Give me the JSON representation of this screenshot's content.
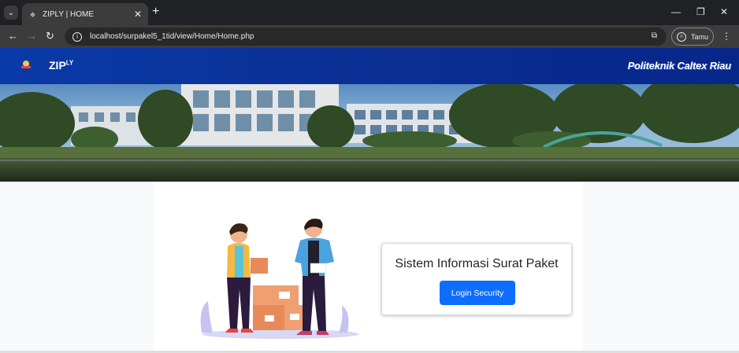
{
  "browser": {
    "tab_title": "ZIPLY | HOME",
    "url": "localhost/surpakel5_1tid/view/Home/Home.php",
    "profile_label": "Tamu"
  },
  "navbar": {
    "brand": "ZIP",
    "brand_sup": "LY",
    "institution_main": "Politeknik Caltex Riau"
  },
  "main": {
    "card_title": "Sistem Informasi Surat Paket",
    "login_button": "Login Security"
  },
  "colors": {
    "navbar": "#0a3aa8",
    "button": "#0d6efd",
    "chrome_dark": "#202124"
  }
}
